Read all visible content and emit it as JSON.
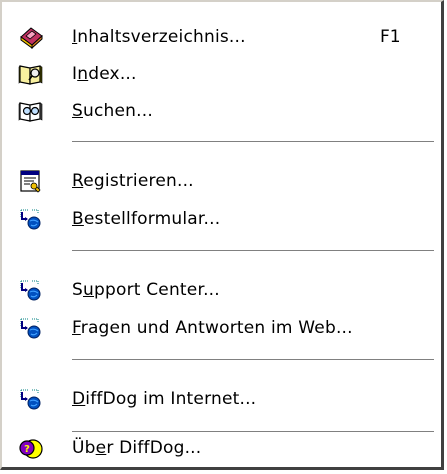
{
  "menu": {
    "items": [
      {
        "label": "Inhaltsverzeichnis...",
        "mnemonic": 0,
        "shortcut": "F1",
        "icon": "book-contents-icon"
      },
      {
        "label": "Index...",
        "mnemonic": 1,
        "shortcut": "",
        "icon": "book-index-icon"
      },
      {
        "label": "Suchen...",
        "mnemonic": 0,
        "shortcut": "",
        "icon": "book-search-icon"
      },
      {
        "label": "Registrieren...",
        "mnemonic": 0,
        "shortcut": "",
        "icon": "registration-certificate-icon"
      },
      {
        "label": "Bestellformular...",
        "mnemonic": 0,
        "shortcut": "",
        "icon": "web-link-icon"
      },
      {
        "label": "Support Center...",
        "mnemonic": 1,
        "shortcut": "",
        "icon": "web-link-icon"
      },
      {
        "label": "Fragen und Antworten im Web...",
        "mnemonic": 0,
        "shortcut": "",
        "icon": "web-link-icon"
      },
      {
        "label": "DiffDog im Internet...",
        "mnemonic": 0,
        "shortcut": "",
        "icon": "web-link-icon"
      },
      {
        "label": "Über DiffDog...",
        "mnemonic": 2,
        "shortcut": "",
        "icon": "about-help-icon"
      }
    ]
  },
  "colors": {
    "menu_background": "#ffffff",
    "text": "#000000",
    "separator_dark": "#808080",
    "border_light": "#d4d0c8",
    "border_dark": "#404040"
  }
}
